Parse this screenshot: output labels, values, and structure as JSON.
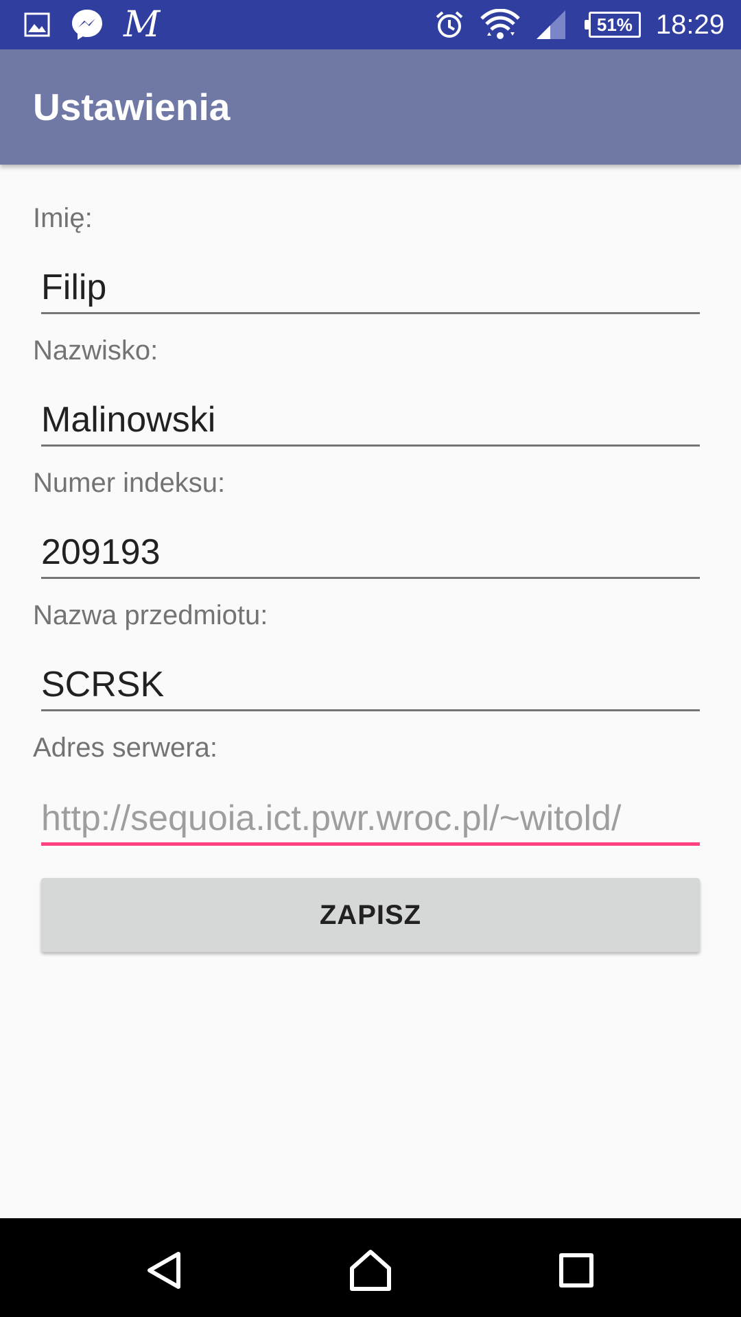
{
  "status_bar": {
    "left_icons": [
      "gallery-icon",
      "messenger-icon",
      "gmail-icon"
    ],
    "right_icons": [
      "alarm-icon",
      "wifi-icon",
      "signal-icon"
    ],
    "battery": "51%",
    "time": "18:29",
    "colors": {
      "background": "#303f9f",
      "foreground": "#ffffff"
    }
  },
  "app_bar": {
    "title": "Ustawienia",
    "color": "#7079a6"
  },
  "form": {
    "first_name": {
      "label": "Imię:",
      "value": "Filip"
    },
    "last_name": {
      "label": "Nazwisko:",
      "value": "Malinowski"
    },
    "index_number": {
      "label": "Numer indeksu:",
      "value": "209193"
    },
    "subject_name": {
      "label": "Nazwa przedmiotu:",
      "value": "SCRSK"
    },
    "server_address": {
      "label": "Adres serwera:",
      "value": "",
      "placeholder": "http://sequoia.ict.pwr.wroc.pl/~witold/",
      "accent_color": "#ff4081"
    },
    "save_label": "ZAPISZ"
  },
  "nav_bar": {
    "icons": [
      "back-icon",
      "home-icon",
      "recents-icon"
    ]
  }
}
